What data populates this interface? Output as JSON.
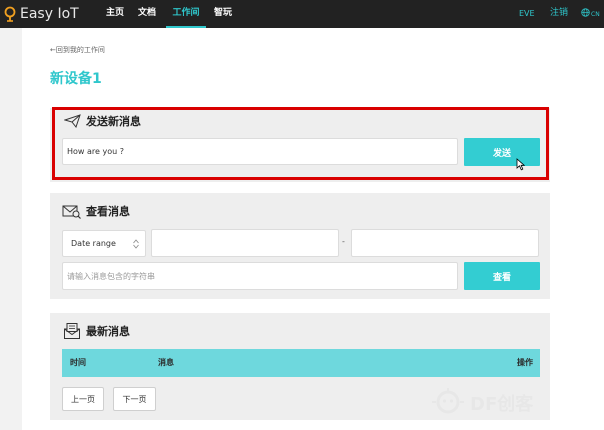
{
  "header": {
    "logo_text": "Easy IoT",
    "nav": [
      "主页",
      "文档",
      "工作间",
      "智玩"
    ],
    "active_nav": "工作间",
    "user": "EVE",
    "logout": "注销",
    "lang": "CN"
  },
  "page": {
    "back_link": "←回到我的工作间",
    "title": "新设备1"
  },
  "send_card": {
    "title": "发送新消息",
    "message_value": "How are you ?",
    "send_label": "发送"
  },
  "view_card": {
    "title": "查看消息",
    "date_range_label": "Date range",
    "date_separator": "-",
    "search_placeholder": "请输入消息包含的字符串",
    "view_label": "查看"
  },
  "latest_card": {
    "title": "最新消息",
    "columns": [
      "时间",
      "消息",
      "操作"
    ],
    "prev_label": "上一页",
    "next_label": "下一页"
  },
  "watermark": "DF创客",
  "colors": {
    "accent": "#33cdd2",
    "highlight_border": "#d90000",
    "topbar": "#222222"
  }
}
